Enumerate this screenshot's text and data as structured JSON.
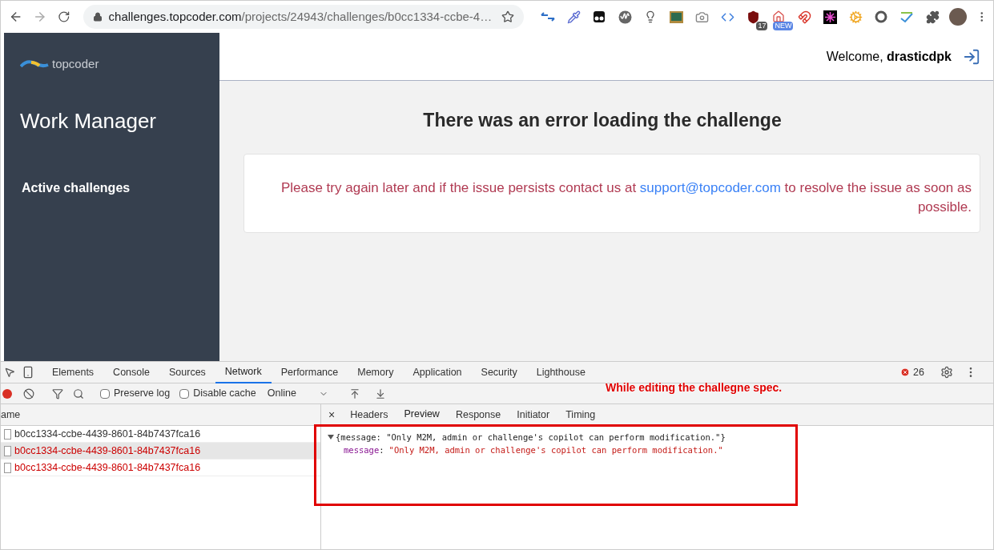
{
  "browser": {
    "url_host": "challenges.topcoder.com",
    "url_path": "/projects/24943/challenges/b0cc1334-ccbe-4…",
    "extensions": [
      {
        "kind": "arrows"
      },
      {
        "kind": "dropper"
      },
      {
        "kind": "glasses"
      },
      {
        "kind": "wave"
      },
      {
        "kind": "bulb"
      },
      {
        "kind": "board"
      },
      {
        "kind": "camera"
      },
      {
        "kind": "code"
      },
      {
        "kind": "shield",
        "badge": "17"
      },
      {
        "kind": "home",
        "badge": "NEW"
      },
      {
        "kind": "magnet"
      },
      {
        "kind": "burst"
      },
      {
        "kind": "gear"
      },
      {
        "kind": "ring"
      },
      {
        "kind": "spell"
      },
      {
        "kind": "puzzle"
      },
      {
        "kind": "avatar"
      }
    ]
  },
  "sidebar": {
    "logo": "topcoder",
    "title": "Work Manager",
    "items": [
      {
        "label": "Active challenges"
      }
    ]
  },
  "header": {
    "welcome": "Welcome, **drasticdpk**"
  },
  "error": {
    "title": "There was an error loading the challenge",
    "message_before": "Please try again later and if the issue persists contact us at ",
    "link": "support@topcoder.com",
    "message_after": " to resolve the issue as soon as possible."
  },
  "devtools": {
    "tabs": [
      {
        "label": "Elements",
        "selected": false
      },
      {
        "label": "Console",
        "selected": false
      },
      {
        "label": "Sources",
        "selected": false
      },
      {
        "label": "Network",
        "selected": true
      },
      {
        "label": "Performance",
        "selected": false
      },
      {
        "label": "Memory",
        "selected": false
      },
      {
        "label": "Application",
        "selected": false
      },
      {
        "label": "Security",
        "selected": false
      },
      {
        "label": "Lighthouse",
        "selected": false
      }
    ],
    "error_count": "26",
    "toolbar": {
      "recording": true,
      "preserve_log": {
        "label": "Preserve log",
        "checked": false
      },
      "disable_cache": {
        "label": "Disable cache",
        "checked": false
      },
      "throttling": "Online"
    },
    "requests": {
      "column": "ame",
      "rows": [
        {
          "name": "b0cc1334-ccbe-4439-8601-84b7437fca16",
          "failed": false,
          "selected": false
        },
        {
          "name": "b0cc1334-ccbe-4439-8601-84b7437fca16",
          "failed": true,
          "selected": true
        },
        {
          "name": "b0cc1334-ccbe-4439-8601-84b7437fca16",
          "failed": true,
          "selected": false
        }
      ]
    },
    "detail": {
      "close": "×",
      "tabs": [
        {
          "label": "Headers",
          "selected": false
        },
        {
          "label": "Preview",
          "selected": true
        },
        {
          "label": "Response",
          "selected": false
        },
        {
          "label": "Initiator",
          "selected": false
        },
        {
          "label": "Timing",
          "selected": false
        }
      ],
      "preview": {
        "summary": "{message: \"Only M2M, admin or challenge's copilot can perform modification.\"}",
        "key": "message",
        "separator": ":",
        "value": "\"Only M2M, admin or challenge's copilot can perform modification.\""
      }
    }
  },
  "annotation": {
    "text": "While editing the challegne spec."
  }
}
